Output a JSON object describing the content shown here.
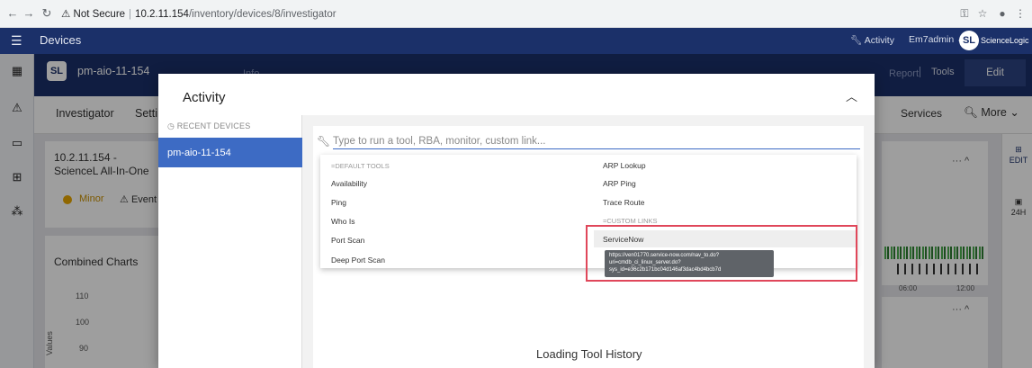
{
  "browser": {
    "not_secure": "Not Secure",
    "host": "10.2.11.154",
    "path": "/inventory/devices/8/investigator"
  },
  "app": {
    "title": "Devices",
    "activity_link": "Activity",
    "user": "Em7admin",
    "logo_text": "ScienceLogic"
  },
  "device": {
    "name": "pm-aio-11-154",
    "info_tab": "Info",
    "report": "Report",
    "tools": "Tools",
    "edit": "Edit"
  },
  "tabs": {
    "investigator": "Investigator",
    "settings": "Setti",
    "services": "Services",
    "more": "More"
  },
  "background": {
    "card_title": "10.2.11.154 - ScienceL All-In-One",
    "minor": "Minor",
    "events": "Event",
    "combined_charts": "Combined Charts",
    "y_ticks": [
      "110",
      "100",
      "90"
    ],
    "y_label": "Values",
    "times": [
      "06:00",
      "12:00"
    ],
    "rail_edit": "EDIT",
    "rail_range": "24H"
  },
  "modal": {
    "title": "Activity",
    "recent_header": "RECENT DEVICES",
    "recent_devices": [
      "pm-aio-11-154"
    ],
    "search_placeholder": "Type to run a tool, RBA, monitor, custom link...",
    "default_tools_header": "DEFAULT TOOLS",
    "custom_links_header": "CUSTOM LINKS",
    "left_column": [
      "Availability",
      "Ping",
      "Who Is",
      "Port Scan",
      "Deep Port Scan"
    ],
    "right_column": [
      "ARP Lookup",
      "ARP Ping",
      "Trace Route"
    ],
    "custom_link": "ServiceNow",
    "tooltip": "https://ven01770.service-now.com/nav_to.do?uri=cmdb_ci_linux_server.do?sys_id=e36c2b171bc04d146af3dac4bd4bcb7d",
    "loading": "Loading Tool History"
  }
}
